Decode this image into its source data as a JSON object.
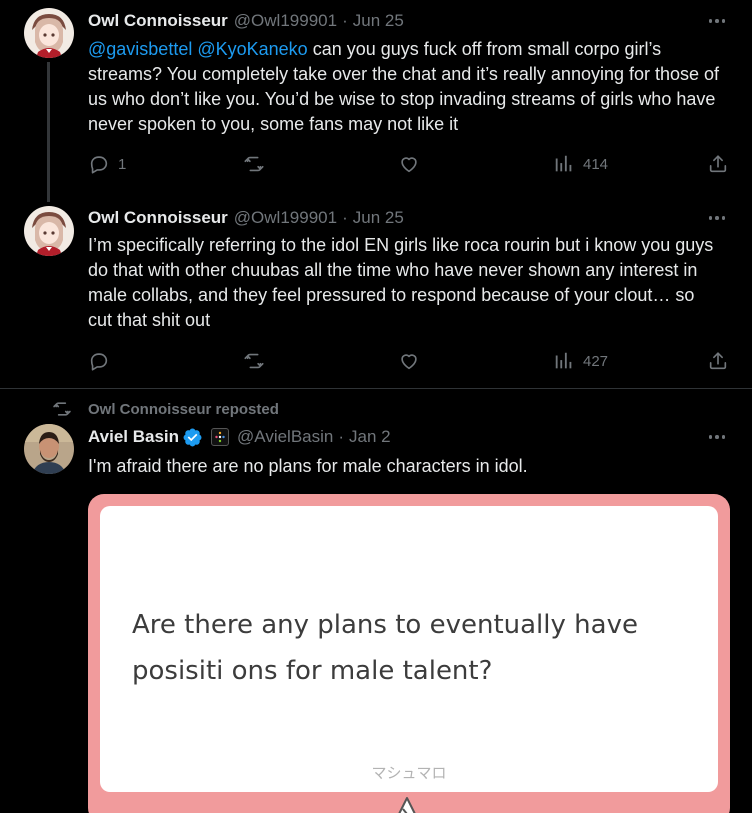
{
  "tweets": [
    {
      "author": "Owl Connoisseur",
      "handle": "@Owl199901",
      "separator": "·",
      "date": "Jun 25",
      "mentions": [
        "@gavisbettel",
        "@KyoKaneko"
      ],
      "text": "can you guys fuck off from small corpo girl’s streams?  You completely take over the chat and it’s really annoying for those of us who don’t like you.  You’d be wise to stop invading streams of girls who have never spoken to you, some fans may not like it",
      "replies": "1",
      "views": "414"
    },
    {
      "author": "Owl Connoisseur",
      "handle": "@Owl199901",
      "separator": "·",
      "date": "Jun 25",
      "text": "I’m specifically referring to the idol EN girls like roca rourin but i know you guys do that with other chuubas all the time who have never shown any interest in male collabs, and they feel pressured to respond because of your clout… so cut that shit out",
      "views": "427"
    }
  ],
  "repost": {
    "label": "Owl Connoisseur reposted",
    "author": "Aviel Basin",
    "handle": "@AvielBasin",
    "separator": "·",
    "date": "Jan 2",
    "text": "I'm afraid there are no plans for male characters in idol.",
    "card": {
      "question": "Are there any plans to eventually have posisiti ons for male talent?",
      "brand": "マシュマロ"
    }
  },
  "colors": {
    "background": "#000000",
    "text": "#e7e9ea",
    "muted": "#71767b",
    "link": "#1d9bf0",
    "verified": "#1d9bf0",
    "card_border": "#f19b9c"
  },
  "icons": [
    "more-icon",
    "reply-icon",
    "retweet-icon",
    "like-icon",
    "views-icon",
    "share-icon",
    "verified-badge-icon",
    "affiliate-badge-icon",
    "marshmallow-logo-icon"
  ]
}
